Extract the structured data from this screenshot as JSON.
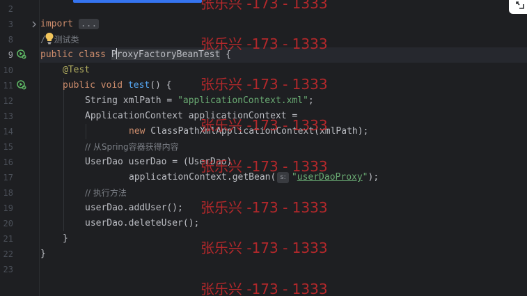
{
  "gutter": {
    "line_numbers": [
      "2",
      "3",
      "8",
      "9",
      "10",
      "11",
      "12",
      "13",
      "14",
      "15",
      "16",
      "17",
      "18",
      "19",
      "20",
      "21",
      "22",
      "23"
    ]
  },
  "code": {
    "line_import": {
      "keyword": "import",
      "folded": "..."
    },
    "line_comment_class": {
      "prefix": "/",
      "slash2": "/",
      "text": " 测试类"
    },
    "line_class": {
      "kw1": "public",
      "kw2": "class",
      "name_first": "P",
      "name_rest": "roxyFactoryBeanTest",
      "brace": " {"
    },
    "line_annotation": {
      "text": "@Test"
    },
    "line_method": {
      "kw1": "public",
      "kw2": "void",
      "name": "test",
      "rest": "() {"
    },
    "line_xmlpath": {
      "decl": "String xmlPath = ",
      "value": "\"applicationContext.xml\"",
      "end": ";"
    },
    "line_ctx_decl": {
      "text": "ApplicationContext applicationContext ="
    },
    "line_ctx_new": {
      "kw": "new",
      "text": " ClassPathXmlApplicationContext(xmlPath);"
    },
    "line_comment_spring": {
      "text": "// 从Spring容器获得内容"
    },
    "line_userdao_decl": {
      "text": "UserDao userDao = (UserDao)"
    },
    "line_getbean": {
      "call": "applicationContext.getBean(",
      "hint": "s:",
      "value_q1": "\"",
      "value_name": "userDaoProxy",
      "value_q2": "\"",
      "end": ");"
    },
    "line_comment_exec": {
      "text": "// 执行方法"
    },
    "line_adduser": {
      "text": "userDao.addUser();"
    },
    "line_deleteuser": {
      "text": "userDao.deleteUser();"
    },
    "line_close_method": {
      "text": "}"
    },
    "line_close_class": {
      "text": "}"
    }
  },
  "watermark": {
    "text": "张乐兴 -173 - 1333"
  },
  "icons": {
    "run": "run-test-icon",
    "fold": "fold-chevron-icon",
    "bulb": "intention-bulb-icon",
    "corner": "corner-action-icon"
  },
  "colors": {
    "background": "#1e1f22",
    "keyword": "#cf8e6d",
    "string": "#6aab73",
    "comment": "#7a7e85",
    "annotation": "#b3ae60",
    "function": "#56a8f5",
    "watermark": "#c0292c"
  }
}
